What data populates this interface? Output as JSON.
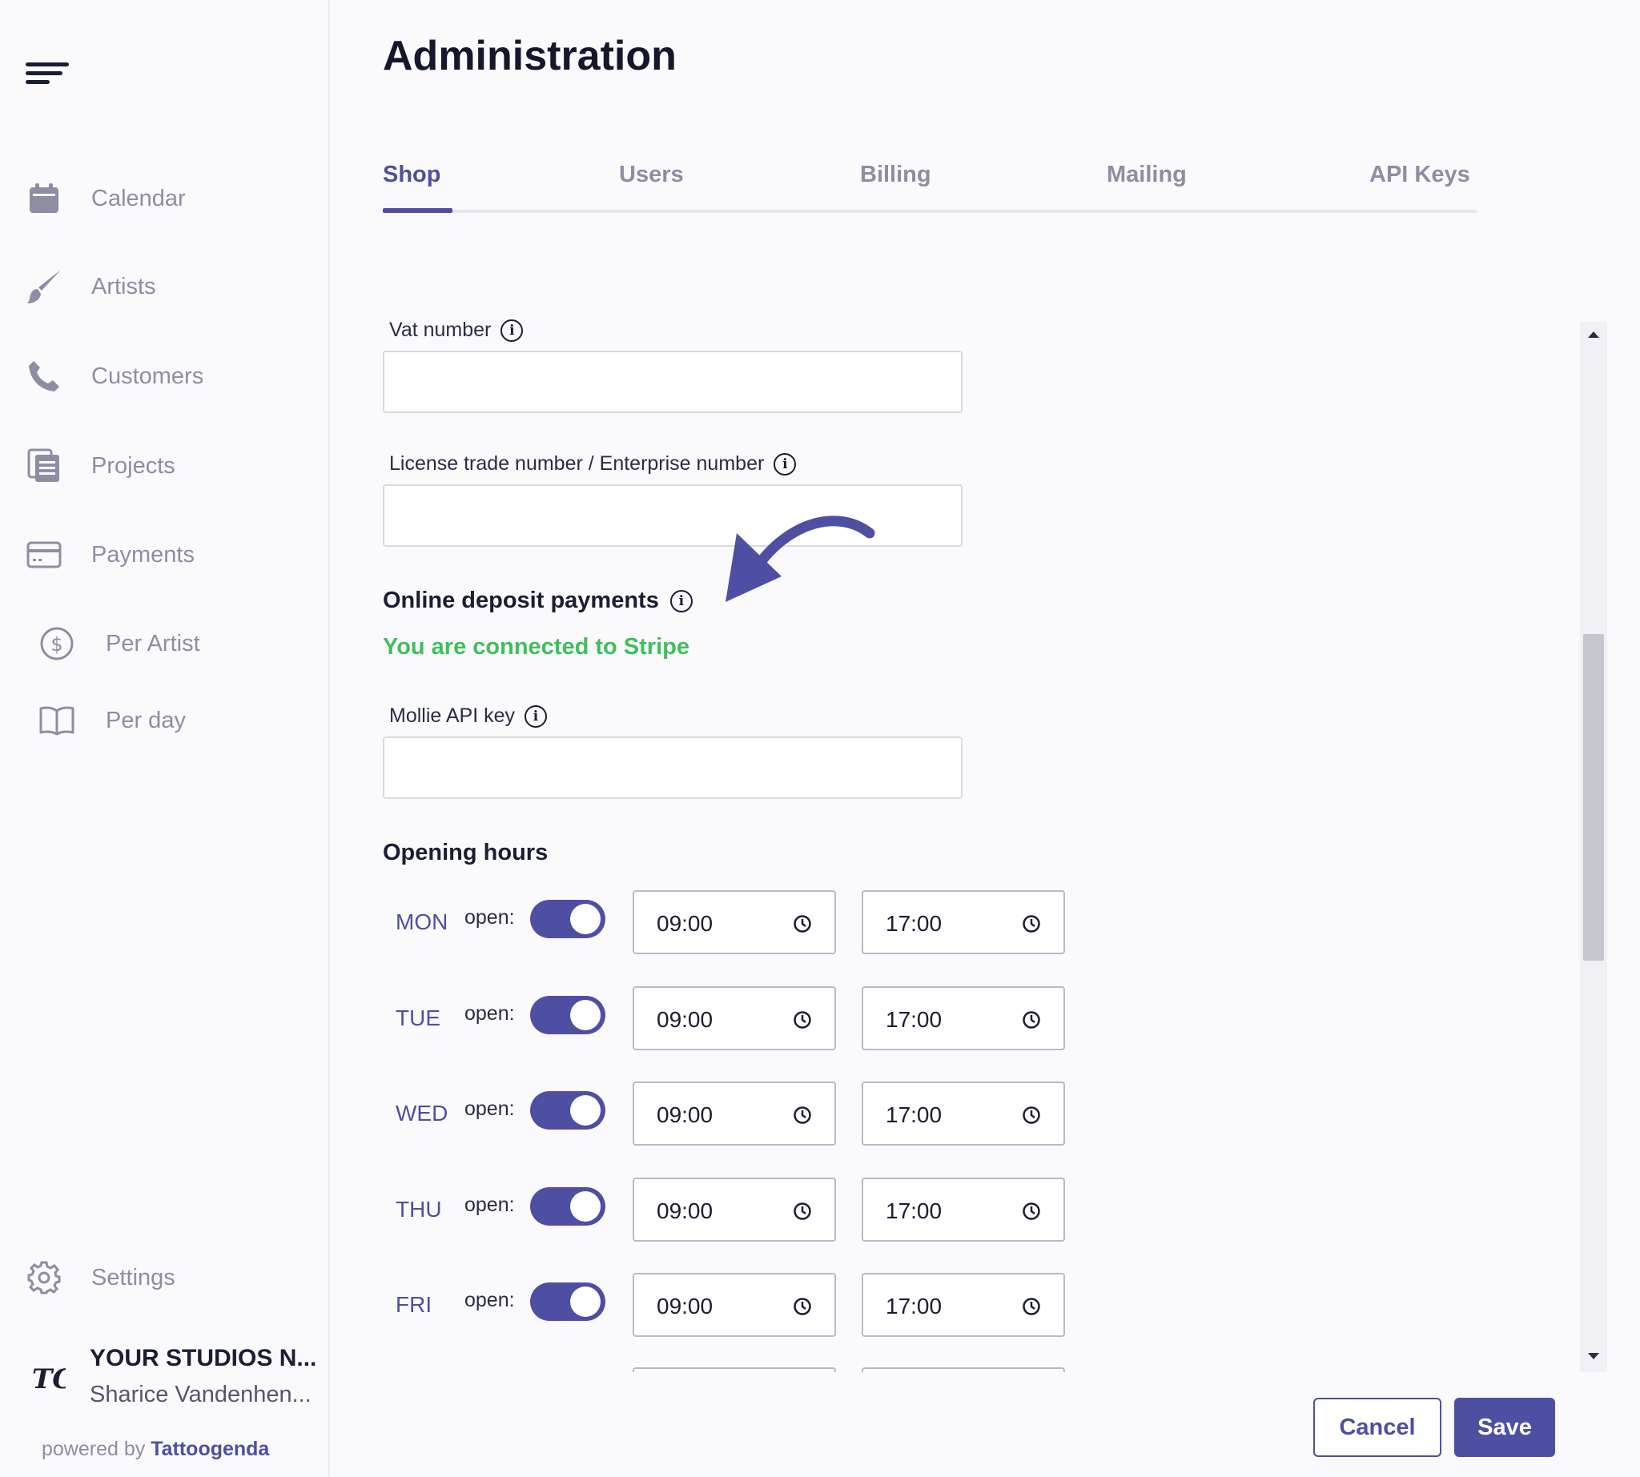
{
  "sidebar": {
    "items": [
      {
        "label": "Calendar",
        "icon": "calendar-icon"
      },
      {
        "label": "Artists",
        "icon": "brush-icon"
      },
      {
        "label": "Customers",
        "icon": "phone-icon"
      },
      {
        "label": "Projects",
        "icon": "documents-icon"
      },
      {
        "label": "Payments",
        "icon": "credit-card-icon"
      },
      {
        "label": "Per Artist",
        "icon": "dollar-circle-icon"
      },
      {
        "label": "Per day",
        "icon": "book-icon"
      }
    ],
    "settings_label": "Settings",
    "studio_name": "YOUR STUDIOS N...",
    "studio_user": "Sharice Vandenhen...",
    "powered_prefix": "powered by",
    "powered_brand": "Tattoogenda",
    "logo_text": "TG"
  },
  "page": {
    "title": "Administration"
  },
  "tabs": [
    {
      "label": "Shop",
      "active": true
    },
    {
      "label": "Users",
      "active": false
    },
    {
      "label": "Billing",
      "active": false
    },
    {
      "label": "Mailing",
      "active": false
    },
    {
      "label": "API Keys",
      "active": false
    }
  ],
  "form": {
    "vat_label": "Vat number",
    "vat_value": "",
    "license_label": "License trade number / Enterprise number",
    "license_value": "",
    "deposit_title": "Online deposit payments",
    "stripe_status": "You are connected to Stripe",
    "mollie_label": "Mollie API key",
    "mollie_value": "",
    "hours_title": "Opening hours",
    "open_label": "open:",
    "days": [
      {
        "day": "MON",
        "open": true,
        "start": "09:00",
        "end": "17:00"
      },
      {
        "day": "TUE",
        "open": true,
        "start": "09:00",
        "end": "17:00"
      },
      {
        "day": "WED",
        "open": true,
        "start": "09:00",
        "end": "17:00"
      },
      {
        "day": "THU",
        "open": true,
        "start": "09:00",
        "end": "17:00"
      },
      {
        "day": "FRI",
        "open": true,
        "start": "09:00",
        "end": "17:00"
      }
    ]
  },
  "actions": {
    "cancel": "Cancel",
    "save": "Save"
  },
  "colors": {
    "accent": "#4e4fa3",
    "success": "#3fbf5c",
    "muted": "#8d8ea3"
  }
}
